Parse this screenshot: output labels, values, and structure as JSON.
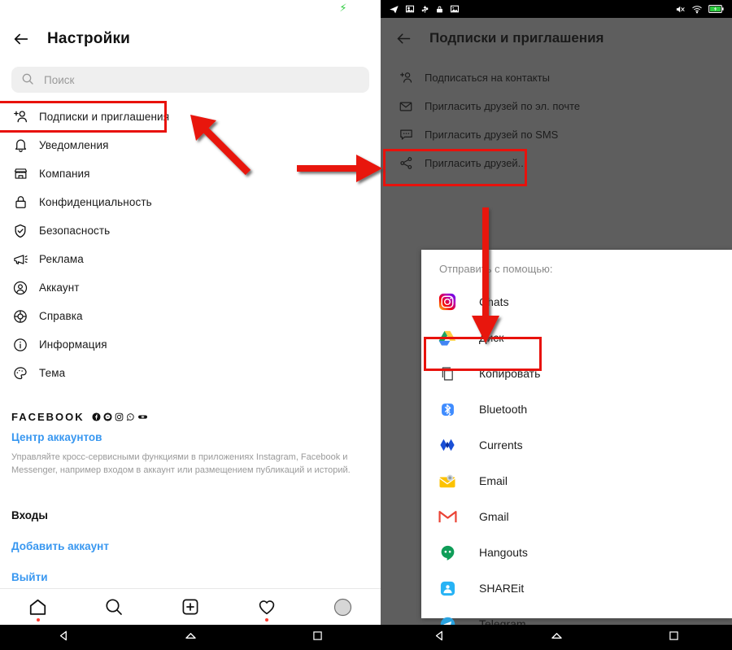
{
  "left_phone": {
    "status_bar": {
      "charging_icon": "bolt-icon"
    },
    "header": {
      "back_icon": "back-arrow-icon",
      "title": "Настройки"
    },
    "search": {
      "icon": "search-icon",
      "placeholder": "Поиск"
    },
    "menu_items": [
      {
        "icon": "add-person-icon",
        "label": "Подписки и приглашения",
        "highlighted": true
      },
      {
        "icon": "bell-icon",
        "label": "Уведомления"
      },
      {
        "icon": "store-icon",
        "label": "Компания"
      },
      {
        "icon": "lock-icon",
        "label": "Конфиденциальность"
      },
      {
        "icon": "shield-check-icon",
        "label": "Безопасность"
      },
      {
        "icon": "megaphone-icon",
        "label": "Реклама"
      },
      {
        "icon": "account-circle-icon",
        "label": "Аккаунт"
      },
      {
        "icon": "lifebuoy-icon",
        "label": "Справка"
      },
      {
        "icon": "info-icon",
        "label": "Информация"
      },
      {
        "icon": "palette-icon",
        "label": "Тема"
      }
    ],
    "facebook_section": {
      "word": "FACEBOOK",
      "brand_icons": [
        "facebook-icon",
        "messenger-icon",
        "instagram-icon",
        "whatsapp-icon",
        "oculus-icon"
      ],
      "accounts_center_link": "Центр аккаунтов",
      "description": "Управляйте кросс-сервисными функциями в приложениях Instagram, Facebook и Messenger, например входом в аккаунт или размещением публикаций и историй."
    },
    "logins_section": {
      "title": "Входы",
      "add_account": "Добавить аккаунт",
      "logout": "Выйти"
    },
    "tabbar": [
      {
        "icon": "home-icon",
        "badge": true
      },
      {
        "icon": "search-icon",
        "badge": false
      },
      {
        "icon": "plus-square-icon",
        "badge": false
      },
      {
        "icon": "heart-icon",
        "badge": true
      },
      {
        "icon": "profile-avatar-icon",
        "badge": false
      }
    ],
    "navbar": [
      {
        "icon": "android-back-icon"
      },
      {
        "icon": "android-home-icon"
      },
      {
        "icon": "android-recents-icon"
      }
    ]
  },
  "right_phone": {
    "status_bar": {
      "left_icons": [
        "telegram-icon",
        "screenshot-icon",
        "usb-icon",
        "lock-icon",
        "sim-icon"
      ],
      "right_icons": [
        "mute-icon",
        "wifi-icon",
        "battery-charging-icon"
      ]
    },
    "header": {
      "back_icon": "back-arrow-icon",
      "title": "Подписки и приглашения"
    },
    "menu_items": [
      {
        "icon": "add-person-icon",
        "label": "Подписаться на контакты"
      },
      {
        "icon": "envelope-icon",
        "label": "Пригласить друзей по эл. почте"
      },
      {
        "icon": "chat-bubble-icon",
        "label": "Пригласить друзей по SMS"
      },
      {
        "icon": "share-icon",
        "label": "Пригласить друзей...",
        "highlighted": true
      }
    ],
    "share_sheet": {
      "title": "Отправить с помощью:",
      "apps": [
        {
          "icon": "instagram-icon",
          "label": "Chats",
          "highlighted": false
        },
        {
          "icon": "google-drive-icon",
          "label": "Диск",
          "highlighted": false
        },
        {
          "icon": "copy-icon",
          "label": "Копировать",
          "highlighted": true
        },
        {
          "icon": "bluetooth-icon",
          "label": "Bluetooth",
          "highlighted": false
        },
        {
          "icon": "currents-icon",
          "label": "Currents",
          "highlighted": false
        },
        {
          "icon": "email-icon",
          "label": "Email",
          "highlighted": false
        },
        {
          "icon": "gmail-icon",
          "label": "Gmail",
          "highlighted": false
        },
        {
          "icon": "hangouts-icon",
          "label": "Hangouts",
          "highlighted": false
        },
        {
          "icon": "shareit-icon",
          "label": "SHAREit",
          "highlighted": false
        },
        {
          "icon": "telegram-icon",
          "label": "Telegram",
          "highlighted": false
        }
      ]
    },
    "navbar": [
      {
        "icon": "android-back-icon"
      },
      {
        "icon": "android-home-icon"
      },
      {
        "icon": "android-recents-icon"
      }
    ]
  },
  "annotations": {
    "highlight_color": "#e8120c",
    "arrows": [
      {
        "name": "arrow-to-subscriptions",
        "direction": "up-left"
      },
      {
        "name": "arrow-to-invite-friends",
        "direction": "right"
      },
      {
        "name": "arrow-to-copy",
        "direction": "down"
      }
    ]
  }
}
